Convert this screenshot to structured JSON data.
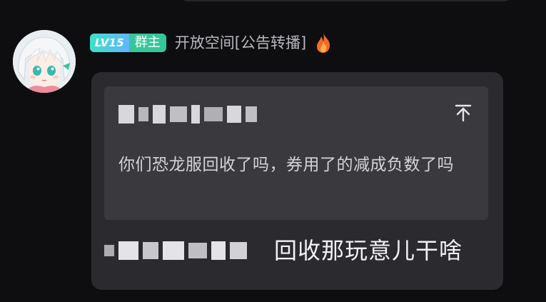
{
  "message": {
    "sender": {
      "level_badge": "LV15",
      "role_badge": "群主",
      "nickname": "开放空间[公告转播]",
      "avatar_icon": "anime-avatar-icon",
      "title_icon": "fire-icon"
    },
    "quote": {
      "author_redacted": true,
      "text": "你们恐龙服回收了吗，券用了的减成负数了吗",
      "collapse_icon": "collapse-up-icon"
    },
    "reply": {
      "mention_redacted": true,
      "text": "回收那玩意儿干啥"
    }
  },
  "colors": {
    "background": "#0e0e10",
    "bubble": "#2b2b2f",
    "quote_card": "#3a3a3e",
    "level_badge": "#4fcfe0",
    "role_badge": "#35c79a",
    "nickname": "#b7b7bd"
  }
}
